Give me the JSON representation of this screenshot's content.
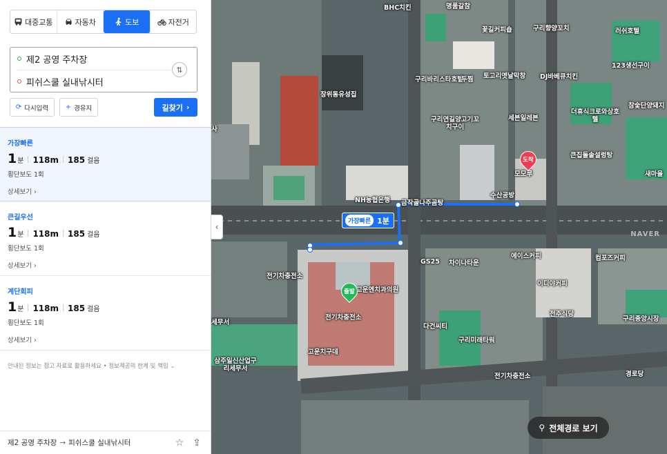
{
  "modes": [
    {
      "label": "대중교통",
      "icon": "bus-icon",
      "active": false
    },
    {
      "label": "자동차",
      "icon": "car-icon",
      "active": false
    },
    {
      "label": "도보",
      "icon": "walk-icon",
      "active": true
    },
    {
      "label": "자전거",
      "icon": "bike-icon",
      "active": false
    }
  ],
  "route": {
    "start": "제2 공영 주차장",
    "end": "피쉬스쿨 실내낚시터",
    "swap_icon": "swap-icon"
  },
  "buttons": {
    "reset": "다시입력",
    "via": "경유지",
    "find": "길찾기"
  },
  "routes": [
    {
      "type": "가장빠른",
      "minutes": "1",
      "min_unit": "분",
      "distance": "118m",
      "steps": "185",
      "step_unit": "걸음",
      "info": "횡단보도 1회",
      "detail": "상세보기"
    },
    {
      "type": "큰길우선",
      "minutes": "1",
      "min_unit": "분",
      "distance": "118m",
      "steps": "185",
      "step_unit": "걸음",
      "info": "횡단보도 1회",
      "detail": "상세보기"
    },
    {
      "type": "계단회피",
      "minutes": "1",
      "min_unit": "분",
      "distance": "118m",
      "steps": "185",
      "step_unit": "걸음",
      "info": "횡단보도 1회",
      "detail": "상세보기"
    }
  ],
  "notice": "안내된 정보는 참고 자료로 활용하세요 • 정보제공의 한계 및 책임",
  "footer": {
    "start": "제2 공영 주차장",
    "arrow": "→",
    "end": "피쉬스쿨 실내낚시터"
  },
  "map": {
    "badge_tag": "가장빠른",
    "badge_time": "1분",
    "start_marker": "출발",
    "end_marker": "도착",
    "full_route_label": "전체경로 보기",
    "watermark": "NAVER",
    "route_color": "#1a6ff5",
    "pois": [
      "BHC치킨",
      "명품갈참",
      "꽃길커피숍",
      "구리향양꼬치",
      "러쉬호텔",
      "구리바리스타호텔",
      "두찜",
      "토고리옛날막창",
      "DJ바베큐치킨",
      "123생선구이",
      "장위동유성집",
      "구리연길양고기꼬치구이",
      "세븐일레븐",
      "더휴식크로와상호텔",
      "참숯단양돼지",
      "큰집돌솥설렁탕",
      "모모루",
      "새마을",
      "NH농협은행",
      "금작골나주곰탕",
      "수산공방",
      "GS25",
      "차이나타운",
      "에이스커피",
      "컴포즈커피",
      "이디야커피",
      "전기차충전소",
      "고운엔치과의원",
      "전주식당",
      "구리중앙시장",
      "다건씨티",
      "구리미래타워",
      "고운치구데",
      "삼주일신산업구리세무서",
      "경로당",
      "세무서",
      "사"
    ]
  }
}
